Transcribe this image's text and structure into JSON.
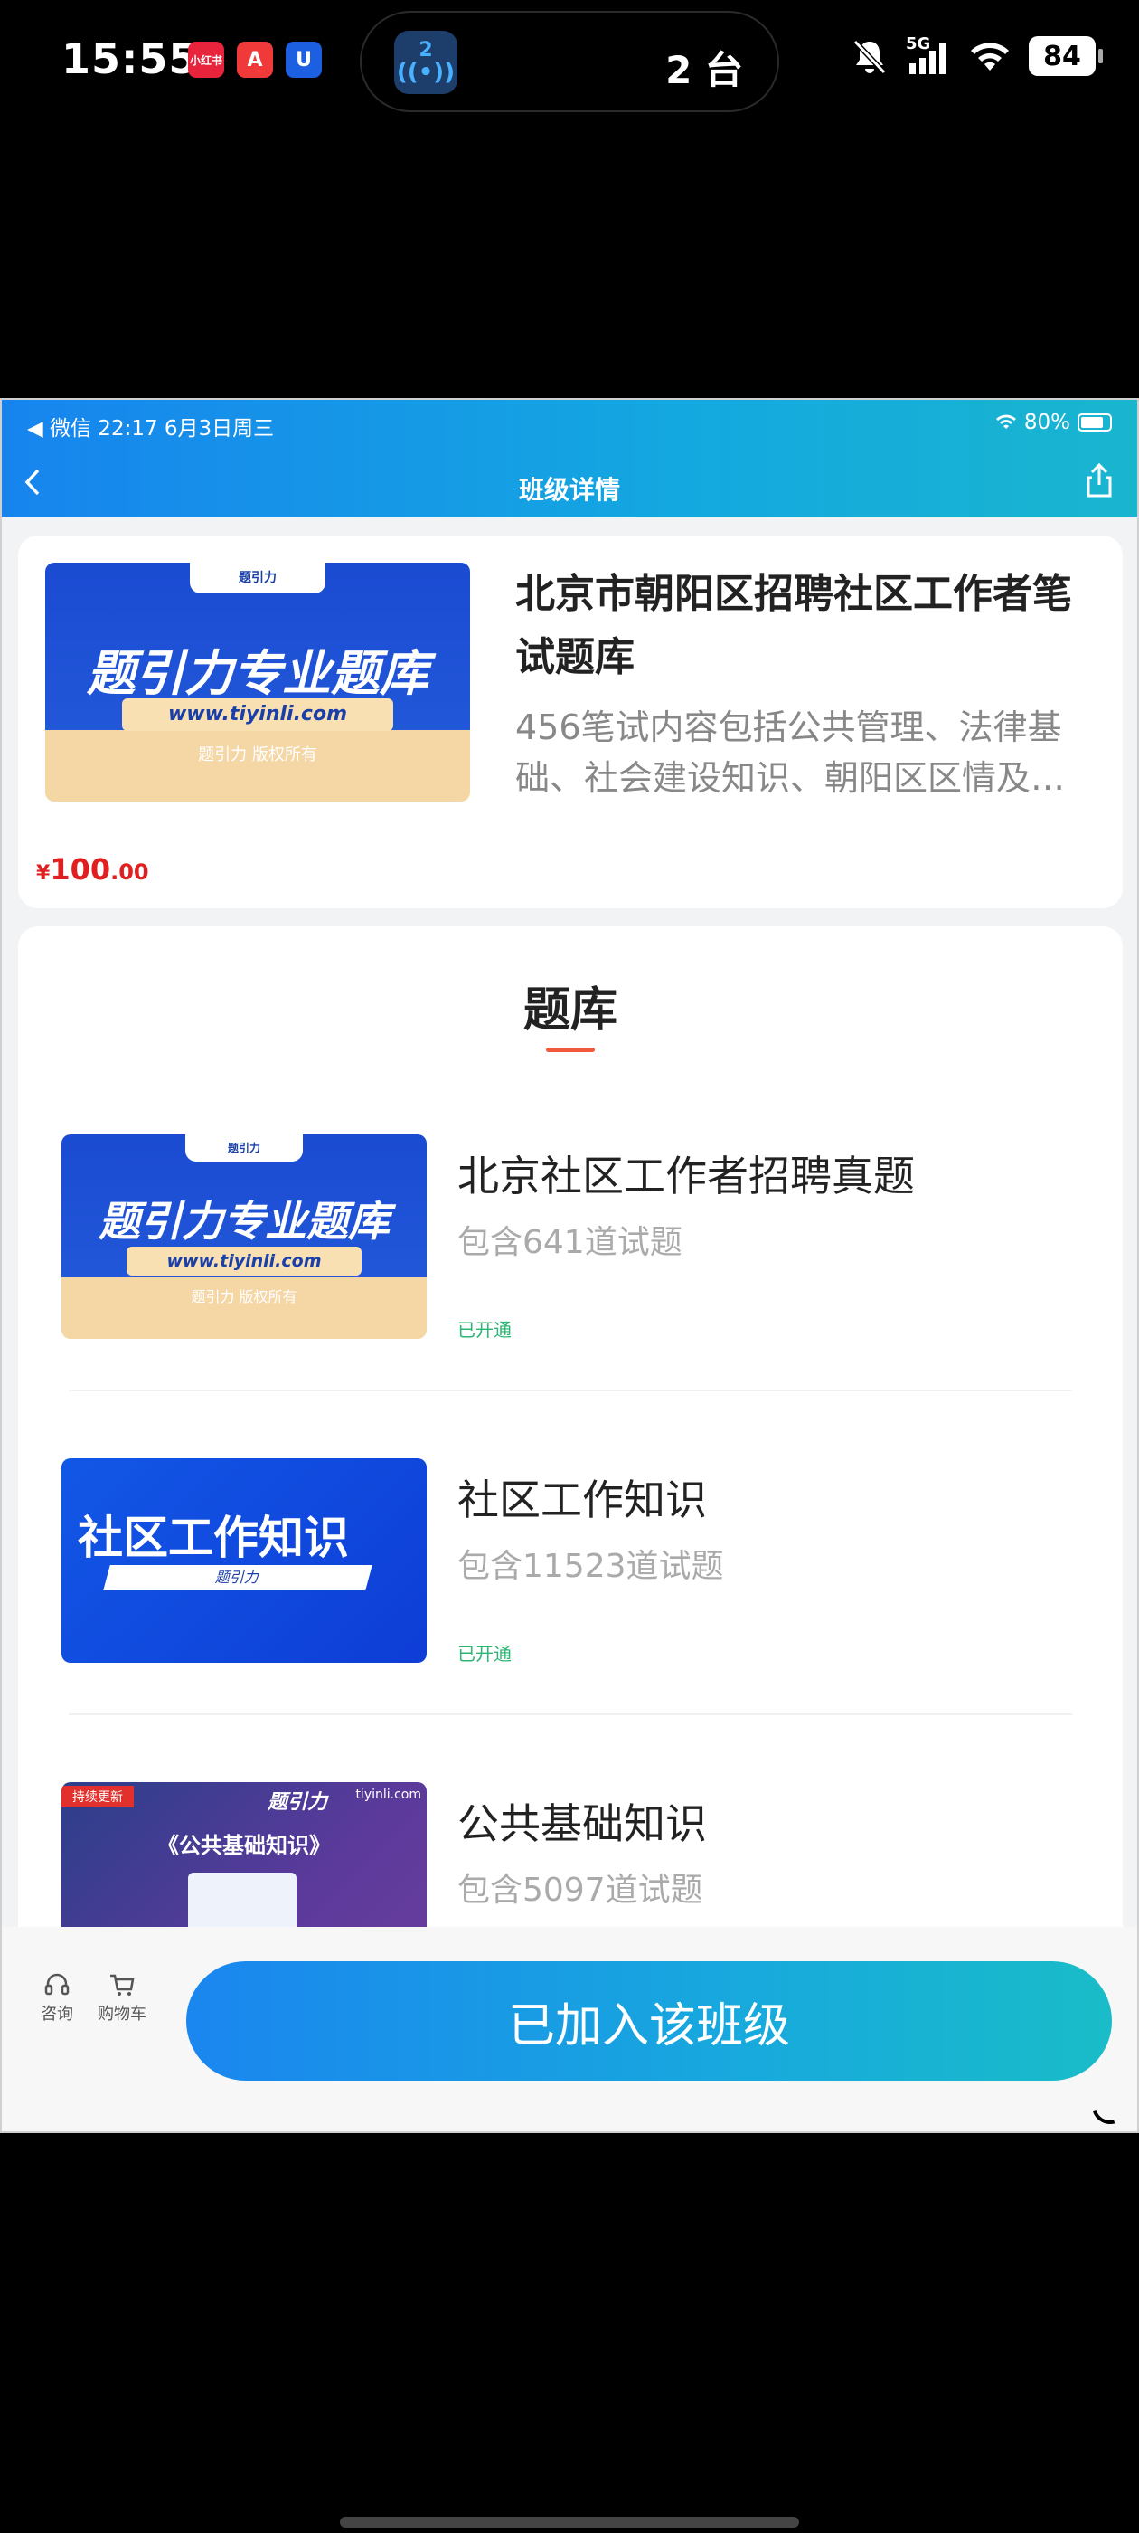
{
  "phone_status": {
    "time": "15:55",
    "island_count": "2",
    "island_text": "2 台",
    "signal": "5G",
    "battery": "84",
    "app_badges": [
      "小红书",
      "A",
      "U"
    ]
  },
  "inner_status": {
    "left": "◀ 微信   22:17   6月3日周三",
    "battery": "80%"
  },
  "header": {
    "title": "班级详情"
  },
  "course": {
    "title": "北京市朝阳区招聘社区工作者笔试题库",
    "description": "456笔试内容包括公共管理、法律基础、社会建设知识、朝阳区区情及…",
    "price_yen": "¥",
    "price_int": "100",
    "price_dec": ".00",
    "thumb": {
      "tag": "题引力",
      "main": "题引力专业题库",
      "url": "www.tiyinli.com",
      "footer": "题引力 版权所有"
    }
  },
  "bank": {
    "title": "题库",
    "items": [
      {
        "title": "北京社区工作者招聘真题",
        "count": "包含641道试题",
        "status": "已开通",
        "thumb": {
          "tag": "题引力",
          "main": "题引力专业题库",
          "url": "www.tiyinli.com",
          "footer": "题引力 版权所有"
        }
      },
      {
        "title": "社区工作知识",
        "count": "包含11523道试题",
        "status": "已开通",
        "thumb": {
          "main": "社区工作知识",
          "sub": "题引力"
        }
      },
      {
        "title": "公共基础知识",
        "count": "包含5097道试题",
        "thumb": {
          "badge": "持续更新",
          "main": "《公共基础知识》",
          "logo": "题引力",
          "site": "tiyinli.com"
        }
      }
    ]
  },
  "bottom": {
    "consult_label": "咨询",
    "cart_label": "购物车",
    "join_label": "已加入该班级"
  },
  "colors": {
    "accent_blue": "#1a86ef",
    "price_red": "#e02020",
    "status_green": "#2bb673",
    "underline_orange": "#f05a3a"
  }
}
